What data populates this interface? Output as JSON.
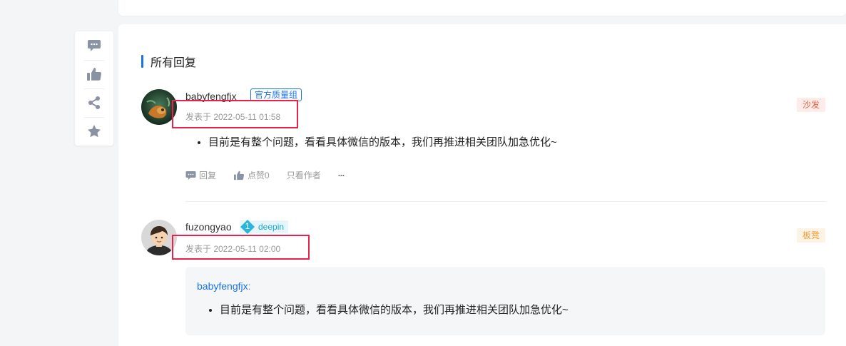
{
  "side_toolbar": {
    "icons": [
      "comment-icon",
      "thumbs-up-icon",
      "share-icon",
      "star-icon"
    ]
  },
  "section": {
    "title": "所有回复",
    "accent_color": "#1a73e8"
  },
  "replies": [
    {
      "username": "babyfengfjx",
      "badge": "官方质量组",
      "timestamp": "发表于 2022-05-11 01:58",
      "floor": "沙发",
      "content": [
        "目前是有整个问题，看看具体微信的版本，我们再推进相关团队加急优化~"
      ],
      "actions": {
        "reply": "回复",
        "like": "点赞0",
        "author_only": "只看作者",
        "more": "···"
      }
    },
    {
      "username": "fuzongyao",
      "level": "1",
      "level_name": "deepin",
      "timestamp": "发表于 2022-05-11 02:00",
      "floor": "板凳",
      "quote": {
        "author": "babyfengfjx",
        "separator": ":",
        "content": [
          "目前是有整个问题，看看具体微信的版本，我们再推进相关团队加急优化~"
        ]
      }
    }
  ],
  "colors": {
    "highlight": "#e8224b",
    "link": "#1a73e8",
    "muted": "#999999"
  }
}
